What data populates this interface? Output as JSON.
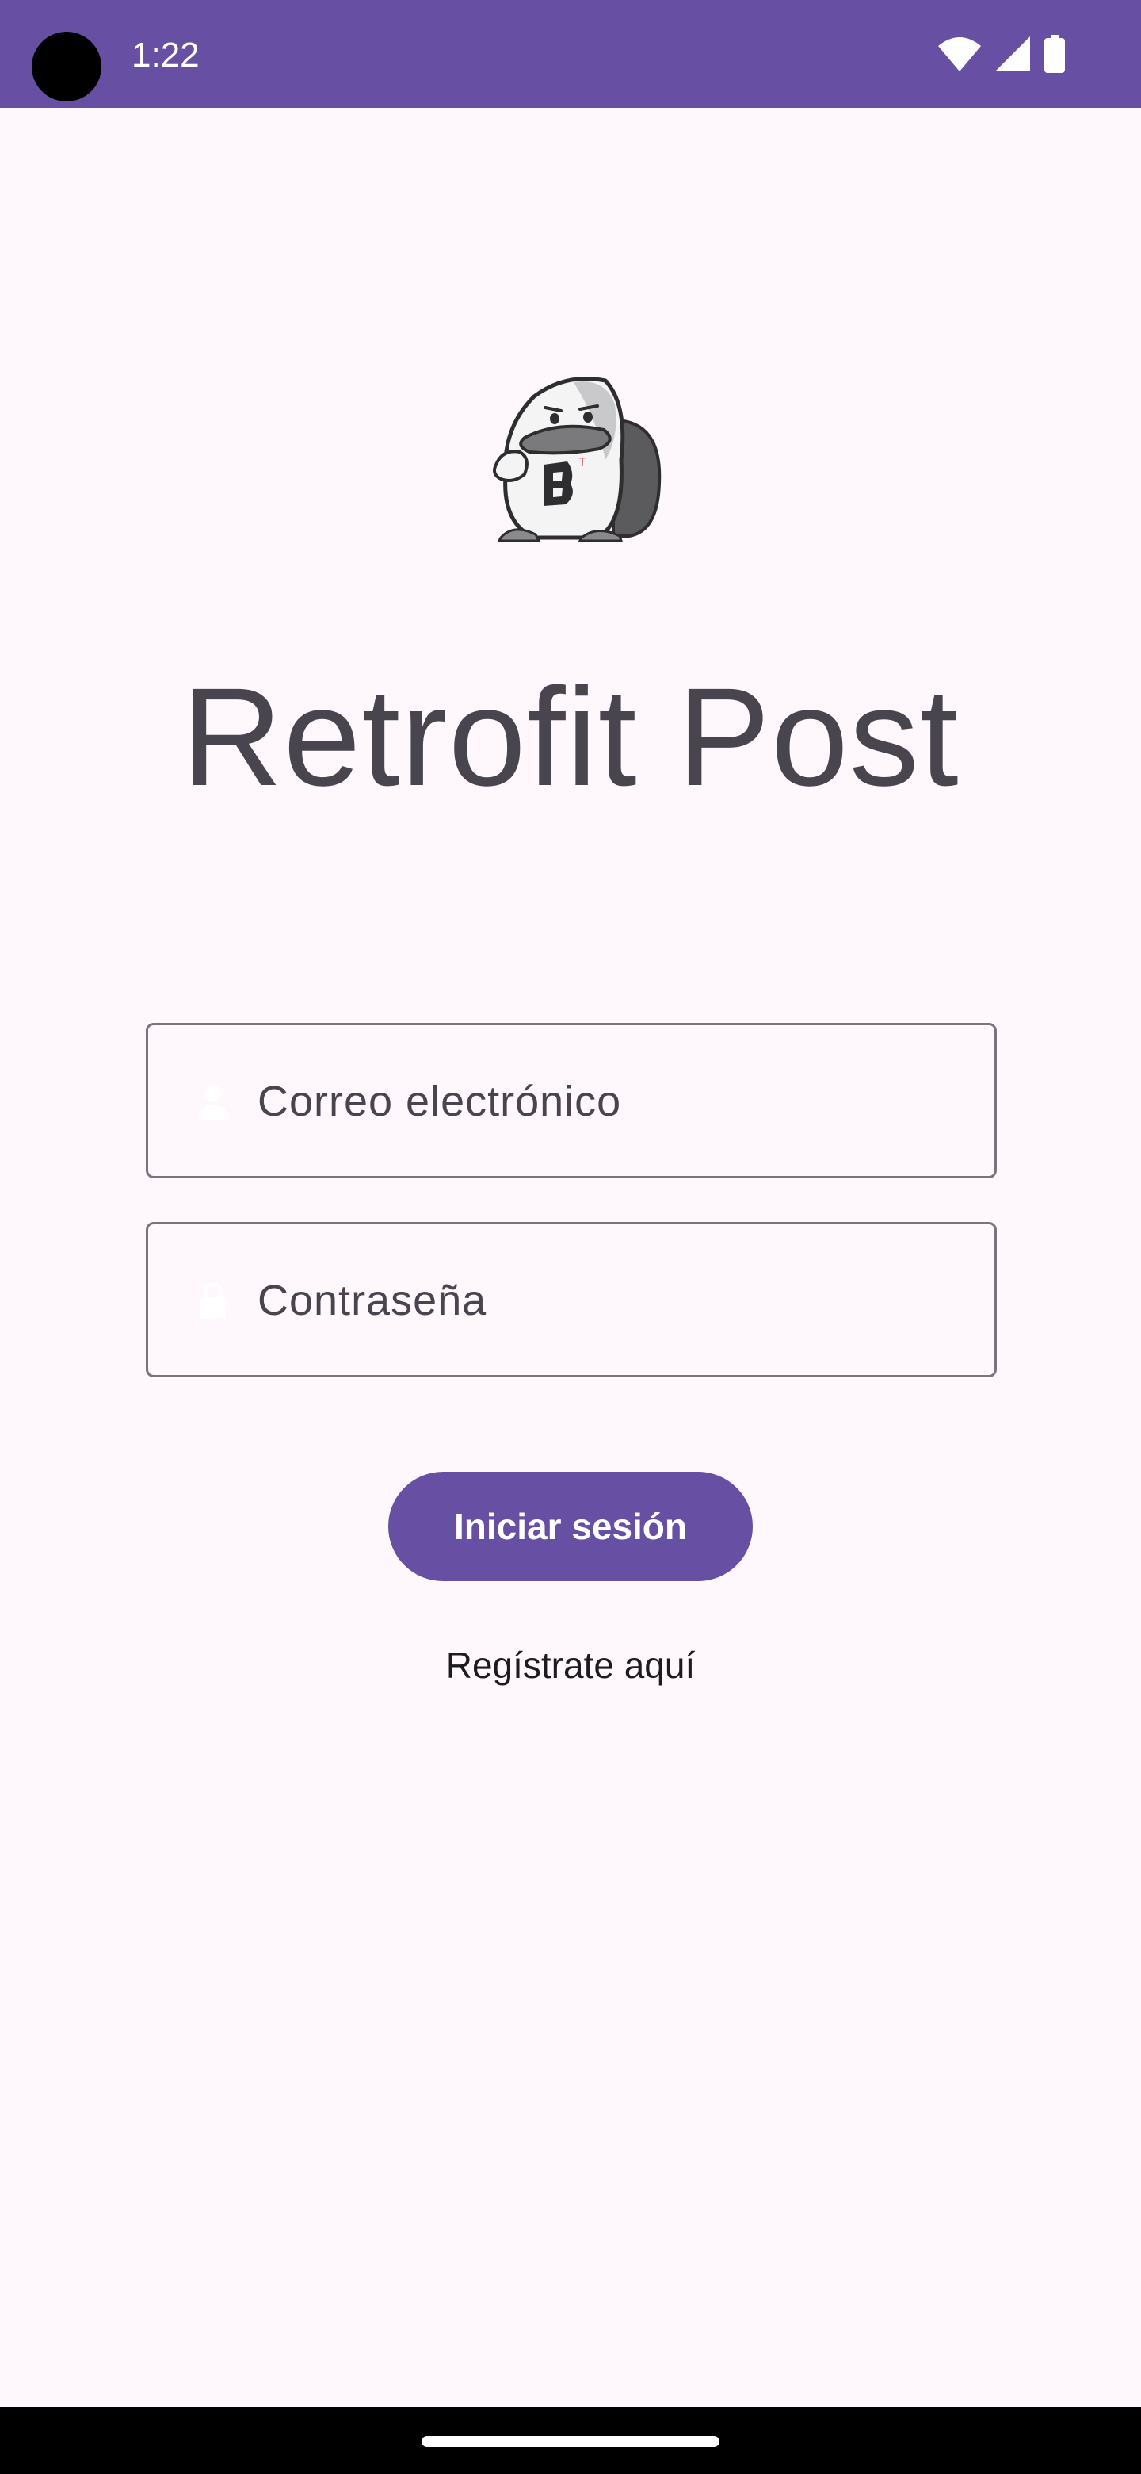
{
  "status_bar": {
    "time": "1:22",
    "icons": [
      "wifi-icon",
      "signal-icon",
      "battery-icon"
    ],
    "background": "#6750A4"
  },
  "app": {
    "title": "Retrofit Post",
    "logo": "mascot-logo"
  },
  "form": {
    "email": {
      "label": "Correo electrónico",
      "icon": "person-icon"
    },
    "password": {
      "label": "Contraseña",
      "icon": "lock-icon"
    }
  },
  "actions": {
    "login_label": "Iniciar sesión",
    "register_label": "Regístrate aquí"
  },
  "colors": {
    "primary": "#6750A4",
    "background": "#FEF7FC",
    "title": "#49454F",
    "outline": "#79747E"
  }
}
